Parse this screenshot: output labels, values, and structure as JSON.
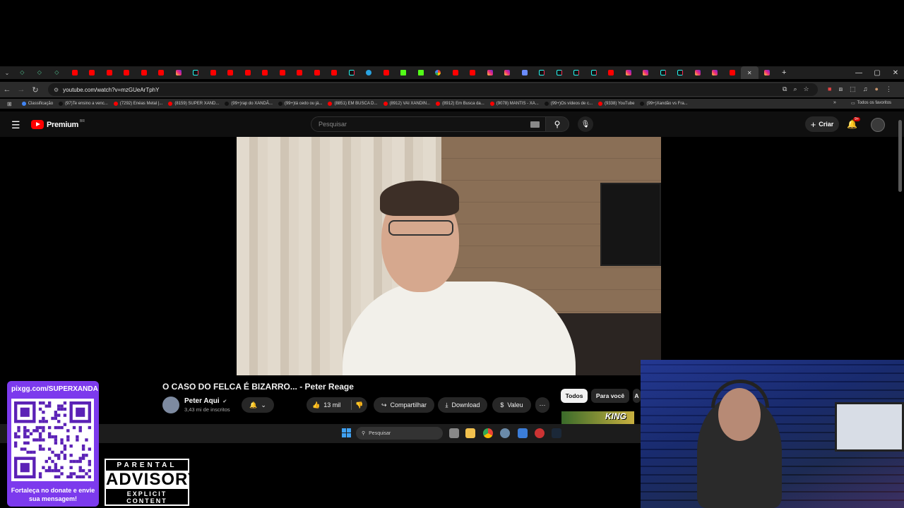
{
  "browser": {
    "url": "youtube.com/watch?v=mzGUeArTphY",
    "bookmarks": [
      {
        "label": "Classificação",
        "color": "#4285f4"
      },
      {
        "label": "(97)Te ensino a venc...",
        "color": "#111111"
      },
      {
        "label": "(7292) Enéas Metal |...",
        "color": "#ff0000"
      },
      {
        "label": "(8159) SUPER XAND...",
        "color": "#ff0000"
      },
      {
        "label": "(99+)rap do XANDÃ...",
        "color": "#111111"
      },
      {
        "label": "(99+)tá cedo ou já...",
        "color": "#111111"
      },
      {
        "label": "(8851) EM BUSCA D...",
        "color": "#ff0000"
      },
      {
        "label": "(8912) VAI XANDIN...",
        "color": "#ff0000"
      },
      {
        "label": "(8912) Em Busca da...",
        "color": "#ff0000"
      },
      {
        "label": "(9078) MANTIS - XA...",
        "color": "#ff0000"
      },
      {
        "label": "(99+)Os vídeos de c...",
        "color": "#111111"
      },
      {
        "label": "(9338) YouTube",
        "color": "#ff0000"
      },
      {
        "label": "(99+)Xandão vs Fra...",
        "color": "#111111"
      }
    ],
    "all_bookmarks": "Todos os favoritos",
    "tab_icons": [
      "code",
      "code",
      "code",
      "yt",
      "yt",
      "yt",
      "yt",
      "yt",
      "yt",
      "ig",
      "tt",
      "yt",
      "yt",
      "yt",
      "yt",
      "yt",
      "yt",
      "yt",
      "yt",
      "tt",
      "tg",
      "yt",
      "kick",
      "kick",
      "g",
      "yt",
      "yt",
      "ig",
      "ig",
      "sq",
      "tt",
      "tt",
      "tt",
      "tt",
      "yt",
      "ig",
      "ig",
      "tt",
      "tt",
      "ig",
      "ig",
      "yt",
      "active",
      "ig"
    ]
  },
  "youtube": {
    "logo": "Premium",
    "logo_region": "BR",
    "search_placeholder": "Pesquisar",
    "create_label": "Criar",
    "notif_count": "9+",
    "video_title": "O CASO DO FELCA É BIZARRO... - Peter Reage",
    "channel": "Peter Aqui",
    "subscribers": "3,43 mi de inscritos",
    "likes": "13 mil",
    "share": "Compartilhar",
    "download": "Download",
    "thanks": "Valeu",
    "chips": [
      "Todos",
      "Para você",
      "A"
    ],
    "suggested_thumb_text": "KING"
  },
  "taskbar": {
    "search_placeholder": "Pesquisar"
  },
  "overlay": {
    "donate_url": "pixgg.com/SUPERXANDA",
    "donate_note": "Fortaleça no donate e envie sua mensagem!",
    "advisory_line1": "PARENTAL",
    "advisory_line2": "ADVISORY",
    "advisory_line3": "EXPLICIT CONTENT"
  }
}
